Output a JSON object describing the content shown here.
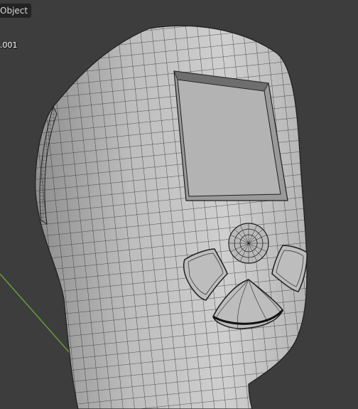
{
  "viewport": {
    "mode_label": "Object",
    "object_name": ".001",
    "colors": {
      "background": "#3d3d3d",
      "mesh_fill": "#c8c8c8",
      "mesh_wire": "#1e1e1e",
      "axis_y": "#6b9b3a",
      "overlay_bg": "#232323"
    }
  }
}
